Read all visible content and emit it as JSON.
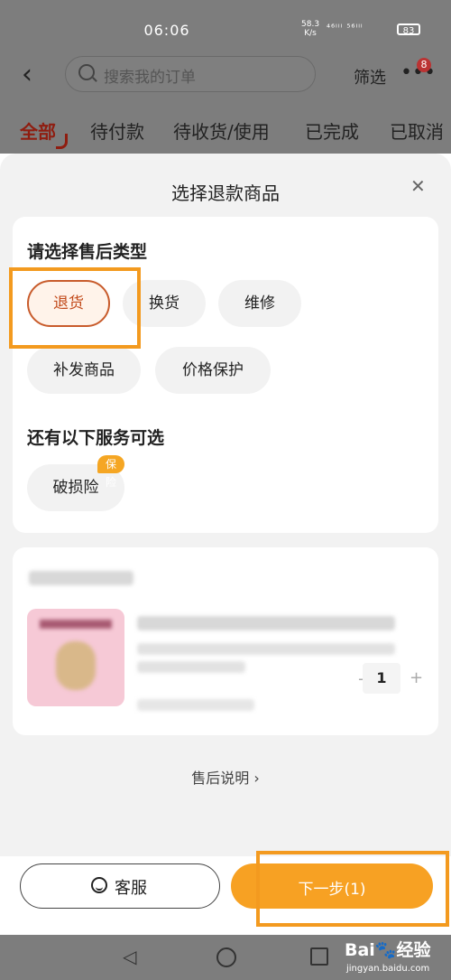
{
  "status_bar": {
    "time": "06:06",
    "net_speed": "58.3",
    "net_unit": "K/s",
    "signal": "⁴⁶ᴵˡˡ ⁵⁶ᴵˡˡ",
    "battery": "83"
  },
  "header": {
    "search_placeholder": "搜索我的订单",
    "filter_label": "筛选",
    "more_badge": "8"
  },
  "tabs": [
    "全部",
    "待付款",
    "待收货/使用",
    "已完成",
    "已取消"
  ],
  "sheet": {
    "title": "选择退款商品",
    "after_sale_title": "请选择售后类型",
    "types": [
      "退货",
      "换货",
      "维修",
      "补发商品",
      "价格保护"
    ],
    "extra_title": "还有以下服务可选",
    "extra_service": "破损险",
    "extra_badge": "保险",
    "quantity": "1",
    "policy_link": "售后说明 ›"
  },
  "footer": {
    "cs_label": "客服",
    "next_label": "下一步(1)"
  },
  "watermark": {
    "brand": "Bai🐾经验",
    "site": "jingyan.baidu.com"
  }
}
